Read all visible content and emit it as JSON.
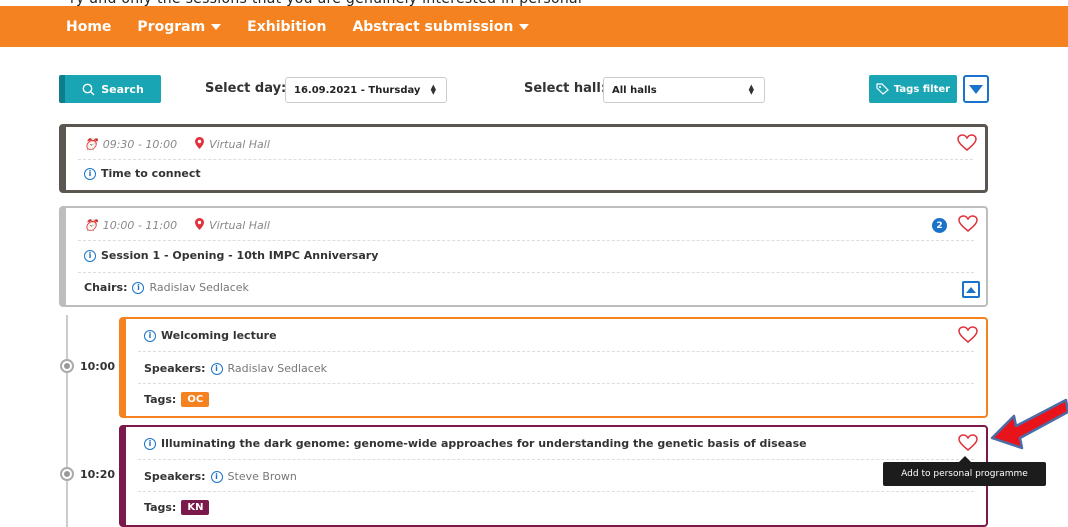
{
  "nav": {
    "items": [
      {
        "label": "Home",
        "dropdown": false
      },
      {
        "label": "Program",
        "dropdown": true
      },
      {
        "label": "Exhibition",
        "dropdown": false
      },
      {
        "label": "Abstract submission",
        "dropdown": true
      }
    ],
    "color": "#f48220"
  },
  "toolbar": {
    "search_label": "Search",
    "day_label": "Select day:",
    "day_value": "16.09.2021 - Thursday",
    "hall_label": "Select hall:",
    "hall_value": "All halls",
    "tags_label": "Tags filter"
  },
  "sessions": [
    {
      "time": "09:30 - 10:00",
      "hall": "Virtual Hall",
      "title": "Time to connect",
      "border_color": "#5b5650"
    },
    {
      "time": "10:00 - 11:00",
      "hall": "Virtual Hall",
      "title": "Session 1 - Opening - 10th IMPC Anniversary",
      "chairs_label": "Chairs:",
      "chair": "Radislav Sedlacek",
      "count": "2",
      "border_color": "#bdbdbd"
    }
  ],
  "talks": [
    {
      "start": "10:00",
      "title": "Welcoming lecture",
      "speakers_label": "Speakers:",
      "speaker": "Radislav Sedlacek",
      "tags_label": "Tags:",
      "tag": "OC",
      "tag_color": "#f48220",
      "border_color": "#f48220"
    },
    {
      "start": "10:20",
      "title": "Illuminating the dark genome: genome-wide approaches for understanding the genetic basis of disease",
      "speakers_label": "Speakers:",
      "speaker": "Steve Brown",
      "tags_label": "Tags:",
      "tag": "KN",
      "tag_color": "#7b1a4a",
      "border_color": "#7b1a4a"
    }
  ],
  "tooltip": "Add to personal programme",
  "accent": "#1aa5b4",
  "heart_color": "#e0323c"
}
